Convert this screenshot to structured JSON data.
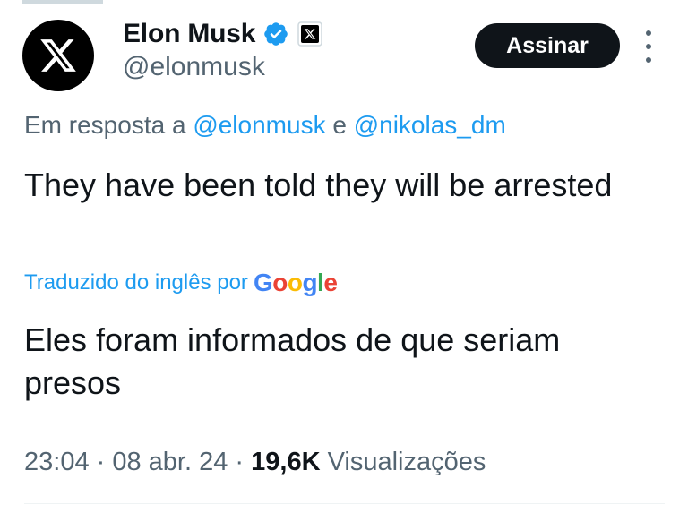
{
  "author": {
    "display_name": "Elon Musk",
    "handle": "@elonmusk",
    "avatar_icon": "x-logo-icon",
    "verified_icon": "verified-badge-icon",
    "affiliate_icon": "x-affiliate-badge-icon"
  },
  "actions": {
    "subscribe_label": "Assinar",
    "more_icon": "more-options-icon"
  },
  "reply": {
    "prefix": "Em resposta a ",
    "mention_1": "@elonmusk",
    "conjunction": " e ",
    "mention_2": "@nikolas_dm"
  },
  "tweet": {
    "text": "They have been told they will be arrested"
  },
  "translation": {
    "label": "Traduzido do inglês por",
    "provider_letters": [
      "G",
      "o",
      "o",
      "g",
      "l",
      "e"
    ],
    "text": "Eles foram informados de que seriam presos"
  },
  "meta": {
    "time": "23:04",
    "separator_1": " · ",
    "date": "08 abr. 24",
    "separator_2": " · ",
    "views_count": "19,6K",
    "views_label": " Visualizações"
  },
  "colors": {
    "accent": "#1d9bf0",
    "text_primary": "#0f1419",
    "text_secondary": "#536471",
    "button_bg": "#0f1419"
  }
}
